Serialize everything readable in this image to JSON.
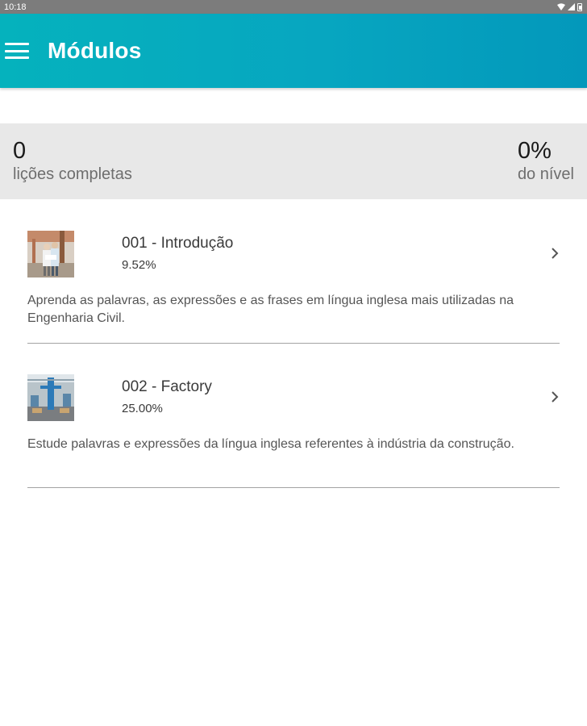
{
  "status_bar": {
    "time": "10:18"
  },
  "app_bar": {
    "title": "Módulos"
  },
  "stats": {
    "lessons_completed_value": "0",
    "lessons_completed_label": "lições completas",
    "level_percent_value": "0%",
    "level_percent_label": "do nível"
  },
  "modules": [
    {
      "title": "001 - Introdução",
      "percent": "9.52%",
      "description": "Aprenda as palavras, as expressões e as frases em língua inglesa mais utilizadas na Engenharia Civil."
    },
    {
      "title": "002 - Factory",
      "percent": "25.00%",
      "description": "Estude palavras e expressões da língua inglesa referentes à indústria da construção."
    }
  ],
  "colors": {
    "app_bar_start": "#05b2bd",
    "app_bar_end": "#0398bb",
    "stats_background": "#e8e8e8",
    "status_bar": "#7c7c7c"
  }
}
